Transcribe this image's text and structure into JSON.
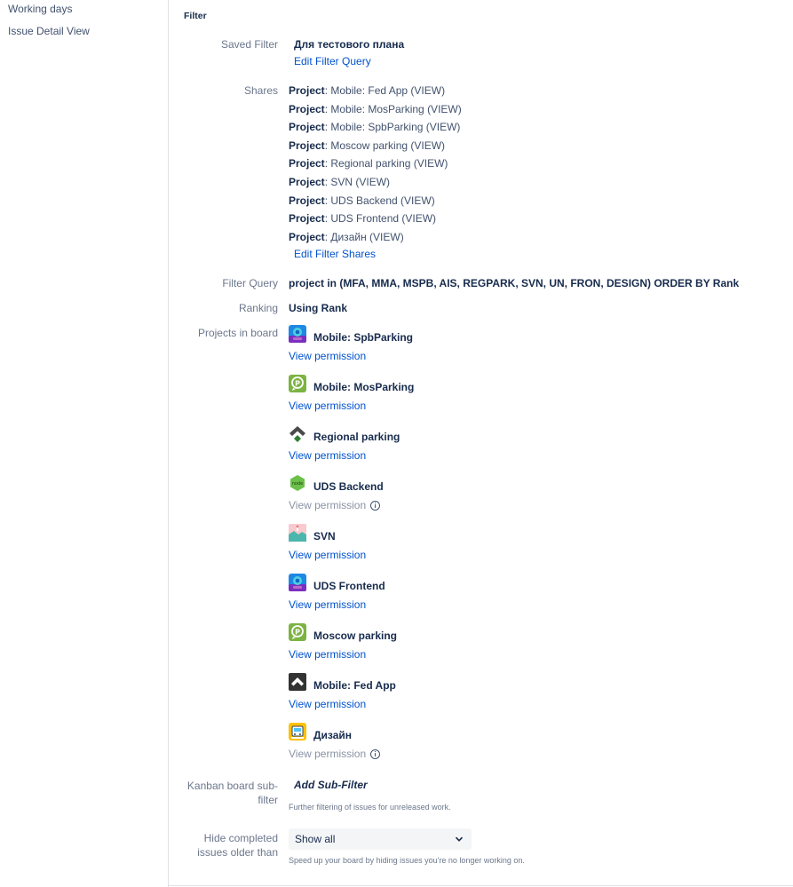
{
  "sidebar": {
    "items": [
      {
        "label": "Working days"
      },
      {
        "label": "Issue Detail View"
      }
    ]
  },
  "filter": {
    "section_title": "Filter",
    "saved_filter_label": "Saved Filter",
    "saved_filter_value": "Для тестового плана",
    "edit_filter_query": "Edit Filter Query",
    "shares_label": "Shares",
    "shares": [
      {
        "type": "Project",
        "text": ": Mobile: Fed App (VIEW)"
      },
      {
        "type": "Project",
        "text": ": Mobile: MosParking (VIEW)"
      },
      {
        "type": "Project",
        "text": ": Mobile: SpbParking (VIEW)"
      },
      {
        "type": "Project",
        "text": ": Moscow parking (VIEW)"
      },
      {
        "type": "Project",
        "text": ": Regional parking (VIEW)"
      },
      {
        "type": "Project",
        "text": ": SVN (VIEW)"
      },
      {
        "type": "Project",
        "text": ": UDS Backend (VIEW)"
      },
      {
        "type": "Project",
        "text": ": UDS Frontend (VIEW)"
      },
      {
        "type": "Project",
        "text": ": Дизайн (VIEW)"
      }
    ],
    "edit_filter_shares": "Edit Filter Shares",
    "filter_query_label": "Filter Query",
    "filter_query_value": "project in (MFA, MMA, MSPB, AIS, REGPARK, SVN, UN, FRON, DESIGN) ORDER BY Rank",
    "ranking_label": "Ranking",
    "ranking_value": "Using Rank",
    "projects_label": "Projects in board",
    "projects": [
      {
        "name": "Mobile: SpbParking",
        "permission": "View permission",
        "icon": "spb-parking-app-icon",
        "disabled": false
      },
      {
        "name": "Mobile: MosParking",
        "permission": "View permission",
        "icon": "parking-p-icon",
        "disabled": false
      },
      {
        "name": "Regional parking",
        "permission": "View permission",
        "icon": "chevron-logo-icon",
        "disabled": false
      },
      {
        "name": "UDS Backend",
        "permission": "View permission",
        "icon": "nodejs-hex-icon",
        "disabled": true
      },
      {
        "name": "SVN",
        "permission": "View permission",
        "icon": "landscape-icon",
        "disabled": false
      },
      {
        "name": "UDS Frontend",
        "permission": "View permission",
        "icon": "spb-parking-app-icon",
        "disabled": false
      },
      {
        "name": "Moscow parking",
        "permission": "View permission",
        "icon": "parking-p-icon",
        "disabled": false
      },
      {
        "name": "Mobile: Fed App",
        "permission": "View permission",
        "icon": "chevron-up-square-icon",
        "disabled": false
      },
      {
        "name": "Дизайн",
        "permission": "View permission",
        "icon": "design-bus-icon",
        "disabled": true
      }
    ],
    "kanban_label_line1": "Kanban board sub-",
    "kanban_label_line2": "filter",
    "add_sub_filter": "Add Sub-Filter",
    "kanban_help": "Further filtering of issues for unreleased work.",
    "hide_label_line1": "Hide completed",
    "hide_label_line2": "issues older than",
    "hide_select_value": "Show all",
    "hide_help": "Speed up your board by hiding issues you're no longer working on."
  },
  "colors": {
    "link": "#0052cc",
    "text": "#172b4d",
    "label": "#6b778c",
    "disabled": "#8993a4"
  }
}
